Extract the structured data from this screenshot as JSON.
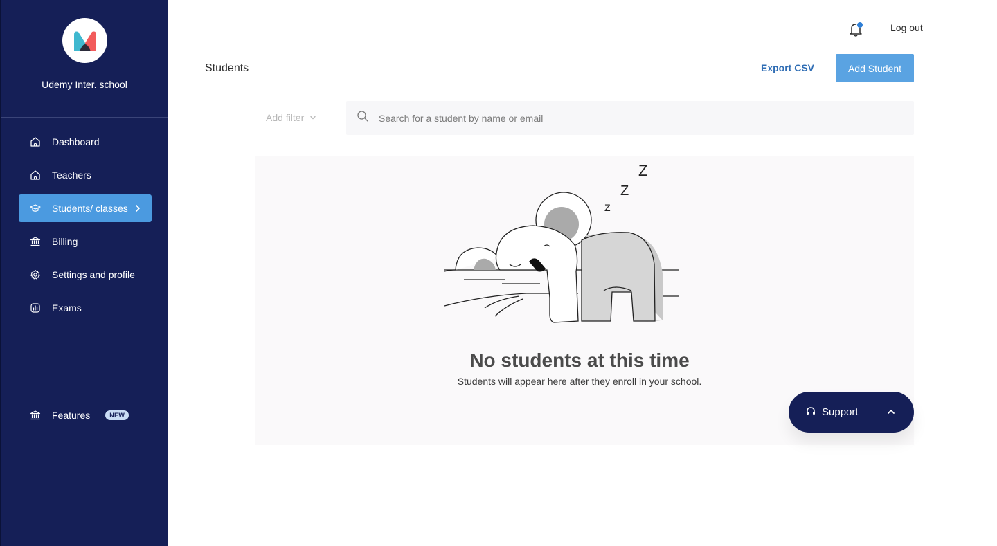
{
  "sidebar": {
    "school_name": "Udemy Inter. school",
    "items": [
      {
        "label": "Dashboard"
      },
      {
        "label": "Teachers"
      },
      {
        "label": "Students/ classes"
      },
      {
        "label": "Billing"
      },
      {
        "label": "Settings and profile"
      },
      {
        "label": "Exams"
      }
    ],
    "features": {
      "label": "Features",
      "badge": "NEW"
    }
  },
  "header": {
    "logout_label": "Log out"
  },
  "main": {
    "title": "Students",
    "export_label": "Export CSV",
    "add_label": "Add Student",
    "filter_label": "Add filter",
    "search": {
      "placeholder": "Search for a student by name or email"
    },
    "empty_state": {
      "title": "No students at this time",
      "subtitle": "Students will appear here after they enroll in your school."
    }
  },
  "support": {
    "label": "Support"
  },
  "colors": {
    "sidebar": "#151f57",
    "accent": "#4b9ae0",
    "button": "#5aa3e2",
    "link": "#2f6db4"
  }
}
